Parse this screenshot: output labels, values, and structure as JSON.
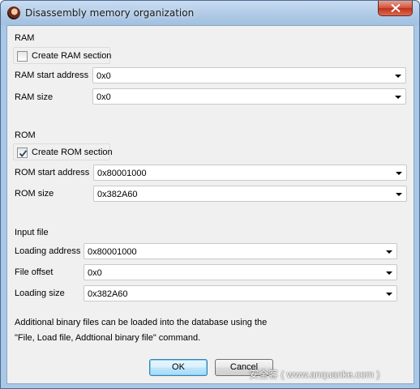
{
  "window": {
    "title": "Disassembly memory organization",
    "close_icon": "close-icon",
    "app_icon": "ida-app-icon"
  },
  "ram": {
    "heading": "RAM",
    "create_label": "Create RAM section",
    "create_checked": false,
    "start_label": "RAM start address",
    "start_value": "0x0",
    "size_label": "RAM size",
    "size_value": "0x0"
  },
  "rom": {
    "heading": "ROM",
    "create_label": "Create ROM section",
    "create_checked": true,
    "start_label": "ROM start address",
    "start_value": "0x80001000",
    "size_label": "ROM size",
    "size_value": "0x382A60"
  },
  "input_file": {
    "heading": "Input file",
    "loading_address_label": "Loading address",
    "loading_address_value": "0x80001000",
    "file_offset_label": "File offset",
    "file_offset_value": "0x0",
    "loading_size_label": "Loading size",
    "loading_size_value": "0x382A60"
  },
  "note": {
    "line1": "Additional binary files can be loaded into the database using the",
    "line2": "\"File, Load file, Addtional binary file\" command."
  },
  "buttons": {
    "ok": "OK",
    "cancel": "Cancel"
  },
  "watermark": "安全客 ( www.anquanke.com )"
}
